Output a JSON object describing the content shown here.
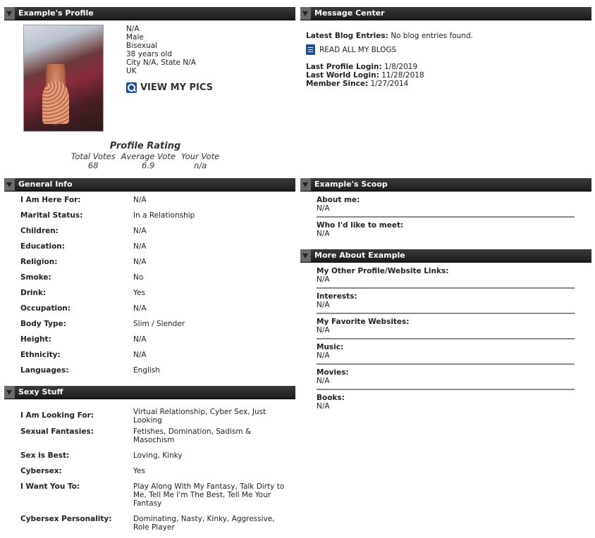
{
  "profile": {
    "header": "Example's Profile",
    "bio": [
      "N/A",
      "Male",
      "Bisexual",
      "38 years old",
      "City N/A, State N/A",
      "UK"
    ],
    "view_pics": "VIEW MY PICS",
    "rating": {
      "title": "Profile Rating",
      "labels": [
        "Total Votes",
        "Average Vote",
        "Your Vote"
      ],
      "values": [
        "68",
        "6.9",
        "n/a"
      ]
    }
  },
  "message_center": {
    "header": "Message Center",
    "latest_blog_label": "Latest Blog Entries:",
    "latest_blog_value": "No blog entries found.",
    "read_all": "READ ALL MY BLOGS",
    "last_profile_label": "Last Profile Login:",
    "last_profile_value": "1/8/2019",
    "last_world_label": "Last World Login:",
    "last_world_value": "11/28/2018",
    "member_since_label": "Member Since:",
    "member_since_value": "1/27/2014"
  },
  "general_info": {
    "header": "General Info",
    "rows": [
      {
        "k": "I Am Here For:",
        "v": "N/A"
      },
      {
        "k": "Marital Status:",
        "v": "In a Relationship"
      },
      {
        "k": "Children:",
        "v": "N/A"
      },
      {
        "k": "Education:",
        "v": "N/A"
      },
      {
        "k": "Religion:",
        "v": "N/A"
      },
      {
        "k": "Smoke:",
        "v": "No"
      },
      {
        "k": "Drink:",
        "v": "Yes"
      },
      {
        "k": "Occupation:",
        "v": "N/A"
      },
      {
        "k": "Body Type:",
        "v": "Slim / Slender"
      },
      {
        "k": "Height:",
        "v": "N/A"
      },
      {
        "k": "Ethnicity:",
        "v": "N/A"
      },
      {
        "k": "Languages:",
        "v": "English"
      }
    ]
  },
  "sexy_stuff": {
    "header": "Sexy Stuff",
    "rows": [
      {
        "k": "I Am Looking For:",
        "v": "Virtual Relationship, Cyber Sex, Just Looking"
      },
      {
        "k": "Sexual Fantasies:",
        "v": "Fetishes, Domination, Sadism & Masochism"
      },
      {
        "k": "Sex is Best:",
        "v": "Loving, Kinky"
      },
      {
        "k": "Cybersex:",
        "v": "Yes"
      },
      {
        "k": "I Want You To:",
        "v": "Play Along With My Fantasy, Talk Dirty to Me, Tell Me I'm The Best, Tell Me Your Fantasy"
      },
      {
        "k": "Cybersex Personality:",
        "v": "Dominating, Nasty, Kinky, Aggressive, Role Player"
      }
    ]
  },
  "scoop": {
    "header": "Example's Scoop",
    "items": [
      {
        "t": "About me:",
        "v": "N/A"
      },
      {
        "t": "Who I'd like to meet:",
        "v": "N/A"
      }
    ]
  },
  "more_about": {
    "header": "More About Example",
    "items": [
      {
        "t": "My Other Profile/Website Links:",
        "v": "N/A"
      },
      {
        "t": "Interests:",
        "v": "N/A"
      },
      {
        "t": "My Favorite Websites:",
        "v": "N/A"
      },
      {
        "t": "Music:",
        "v": "N/A"
      },
      {
        "t": "Movies:",
        "v": "N/A"
      },
      {
        "t": "Books:",
        "v": "N/A"
      }
    ]
  }
}
